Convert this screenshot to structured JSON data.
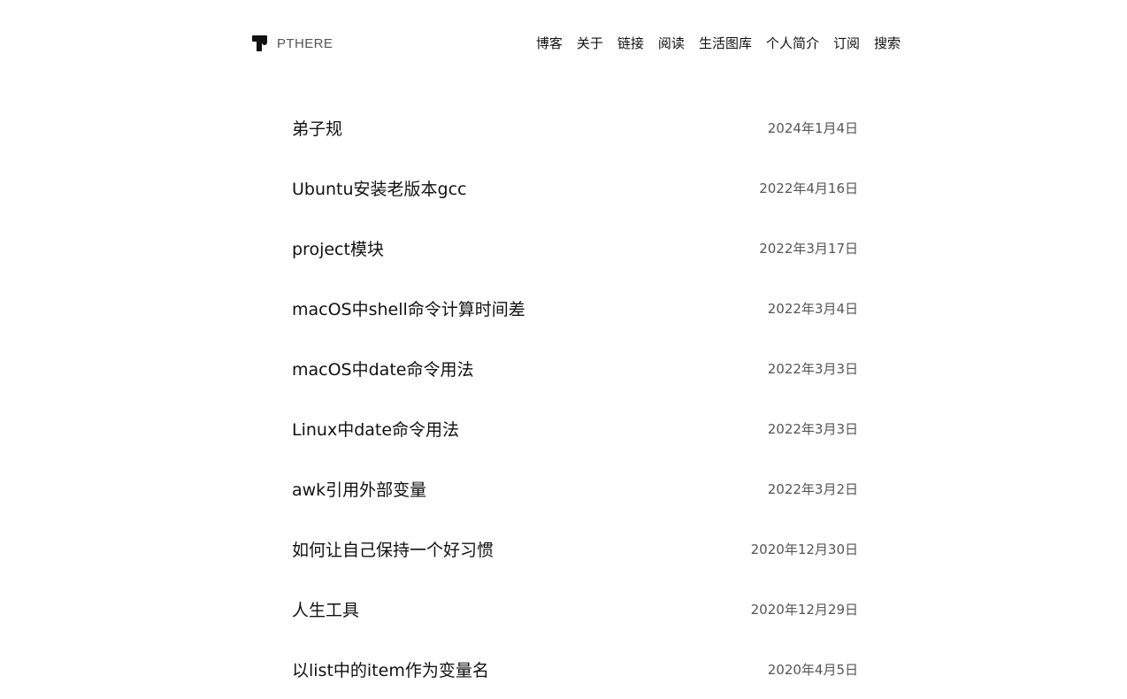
{
  "header": {
    "brand": {
      "name": "PTHERE",
      "logo_icon": "logo-p-icon"
    },
    "nav": [
      {
        "label": "博客"
      },
      {
        "label": "关于"
      },
      {
        "label": "链接"
      },
      {
        "label": "阅读"
      },
      {
        "label": "生活图库"
      },
      {
        "label": "个人简介"
      },
      {
        "label": "订阅"
      },
      {
        "label": "搜索"
      }
    ]
  },
  "posts": [
    {
      "title": "弟子规",
      "date": "2024年1月4日"
    },
    {
      "title": "Ubuntu安装老版本gcc",
      "date": "2022年4月16日"
    },
    {
      "title": "project模块",
      "date": "2022年3月17日"
    },
    {
      "title": "macOS中shell命令计算时间差",
      "date": "2022年3月4日"
    },
    {
      "title": "macOS中date命令用法",
      "date": "2022年3月3日"
    },
    {
      "title": "Linux中date命令用法",
      "date": "2022年3月3日"
    },
    {
      "title": "awk引用外部变量",
      "date": "2022年3月2日"
    },
    {
      "title": "如何让自己保持一个好习惯",
      "date": "2020年12月30日"
    },
    {
      "title": "人生工具",
      "date": "2020年12月29日"
    },
    {
      "title": "以list中的item作为变量名",
      "date": "2020年4月5日"
    }
  ]
}
